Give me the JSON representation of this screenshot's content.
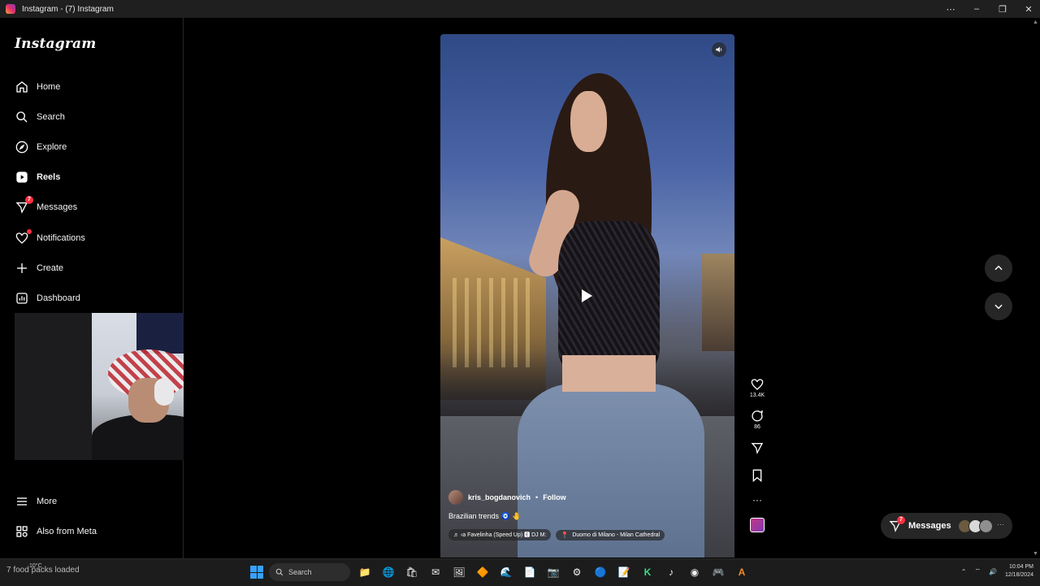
{
  "window": {
    "title": "Instagram - (7) Instagram",
    "controls": [
      "⋯",
      "–",
      "❐",
      "✕"
    ]
  },
  "sidebar": {
    "logo": "Instagram",
    "items": [
      {
        "label": "Home",
        "icon": "home-icon"
      },
      {
        "label": "Search",
        "icon": "search-icon"
      },
      {
        "label": "Explore",
        "icon": "compass-icon"
      },
      {
        "label": "Reels",
        "icon": "reels-icon",
        "active": true
      },
      {
        "label": "Messages",
        "icon": "messenger-icon",
        "badge": "7"
      },
      {
        "label": "Notifications",
        "icon": "heart-icon",
        "dot": true
      },
      {
        "label": "Create",
        "icon": "plus-icon"
      },
      {
        "label": "Dashboard",
        "icon": "dashboard-icon"
      }
    ],
    "bottom_items": [
      {
        "label": "More",
        "icon": "menu-icon"
      },
      {
        "label": "Also from Meta",
        "icon": "meta-apps-icon"
      }
    ]
  },
  "reel": {
    "username": "kris_bogdanovich",
    "separator": "•",
    "follow_label": "Follow",
    "caption": "Brazilian trends 🧿 🤚",
    "audio": "♬ ‹a Favelinha (Speed Up) 🅴 DJ M:",
    "location": "Duomo di Milano - Milan Cathedral",
    "likes": "13.4K",
    "comments": "86"
  },
  "messages_pill": {
    "label": "Messages",
    "badge": "7"
  },
  "taskbar": {
    "left_text": "7 food packs loaded",
    "weather": "10°C",
    "search_label": "Search",
    "time": "10:04 PM",
    "date": "12/18/2024",
    "apps": [
      "📁",
      "🌐",
      "🛍",
      "✉",
      "🖼",
      "🔶",
      "🌊",
      "📄",
      "📷",
      "⚙",
      "🔵",
      "📝",
      "K",
      "♪",
      "◉",
      "🎮",
      "A"
    ]
  },
  "colors": {
    "background": "#000000",
    "accent_red": "#ff3040",
    "panel": "#262626"
  }
}
